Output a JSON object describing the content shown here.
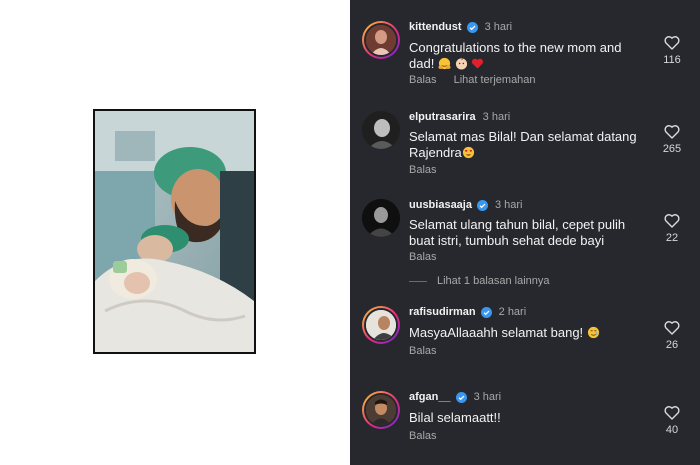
{
  "colors": {
    "panel_bg": "#26282e",
    "verified": "#3897f0",
    "muted": "#a8a8a8"
  },
  "photo": {
    "description_icon": "newborn-photo"
  },
  "comments": [
    {
      "user": "kittendust",
      "verified": true,
      "time": "3 hari",
      "text": "Congratulations to the new mom and dad!",
      "emojis": [
        "hugging-face",
        "baby",
        "red-heart"
      ],
      "reply_label": "Balas",
      "translate_label": "Lihat terjemahan",
      "likes": "116"
    },
    {
      "user": "elputrasarira",
      "verified": false,
      "time": "3 hari",
      "text": "Selamat mas Bilal! Dan selamat datang Rajendra",
      "emojis": [
        "heart-eyes"
      ],
      "reply_label": "Balas",
      "likes": "265"
    },
    {
      "user": "uusbiasaaja",
      "verified": true,
      "time": "3 hari",
      "text": "Selamat ulang tahun bilal, cepet pulih buat istri, tumbuh sehat dede bayi",
      "reply_label": "Balas",
      "likes": "22",
      "more_replies": "Lihat 1 balasan lainnya"
    },
    {
      "user": "rafisudirman",
      "verified": true,
      "time": "2 hari",
      "text": "MasyaAllaaahh selamat bang!",
      "emojis": [
        "smiling-face-with-tear"
      ],
      "reply_label": "Balas",
      "likes": "26"
    },
    {
      "user": "afgan__",
      "verified": true,
      "time": "3 hari",
      "text": "Bilal selamaatt!!",
      "reply_label": "Balas",
      "likes": "40"
    }
  ]
}
